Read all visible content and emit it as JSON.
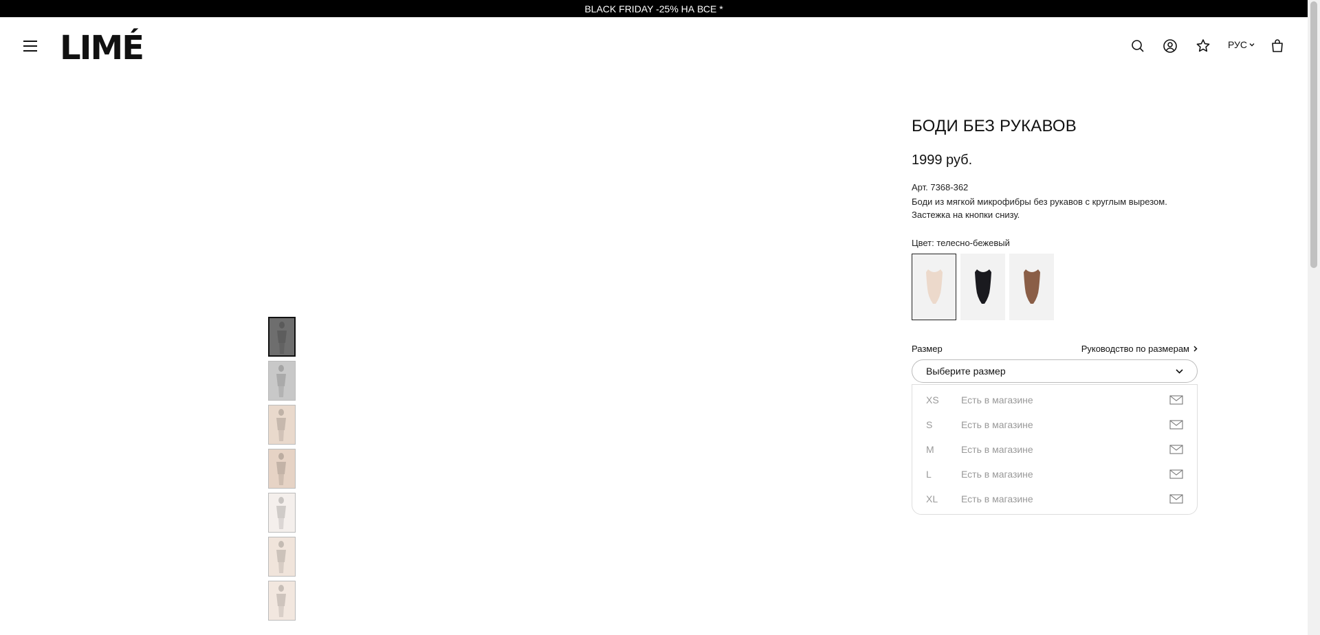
{
  "promo": {
    "text": "BLACK FRIDAY -25% НА ВСЕ *"
  },
  "header": {
    "logo": "LIMÉ",
    "language": "РУС",
    "icons": [
      "menu-icon",
      "search-icon",
      "account-icon",
      "favorites-icon",
      "cart-icon"
    ]
  },
  "product": {
    "title": "БОДИ БЕЗ РУКАВОВ",
    "price": "1999 руб.",
    "article": "Арт. 7368-362",
    "description": "Боди из мягкой микрофибры без рукавов с круглым вырезом. Застежка на кнопки снизу.",
    "color_label": "Цвет: телесно-бежевый",
    "swatches": [
      {
        "color": "#ecd9cb",
        "selected": true
      },
      {
        "color": "#1a1a1f",
        "selected": false
      },
      {
        "color": "#8a5e47",
        "selected": false
      }
    ]
  },
  "size": {
    "label": "Размер",
    "guide_label": "Руководство по размерам",
    "placeholder": "Выберите размер",
    "options": [
      {
        "size": "XS",
        "availability": "Есть в магазине"
      },
      {
        "size": "S",
        "availability": "Есть в магазине"
      },
      {
        "size": "M",
        "availability": "Есть в магазине"
      },
      {
        "size": "L",
        "availability": "Есть в магазине"
      },
      {
        "size": "XL",
        "availability": "Есть в магазине"
      }
    ]
  },
  "gallery": {
    "thumbnails": [
      {
        "tone": "#6e6e6e",
        "active": true
      },
      {
        "tone": "#c8c8c8",
        "active": false
      },
      {
        "tone": "#e9d9cc",
        "active": false
      },
      {
        "tone": "#e6d3c5",
        "active": false
      },
      {
        "tone": "#f4efec",
        "active": false
      },
      {
        "tone": "#f0e4db",
        "active": false
      },
      {
        "tone": "#f2e7df",
        "active": false
      }
    ]
  }
}
